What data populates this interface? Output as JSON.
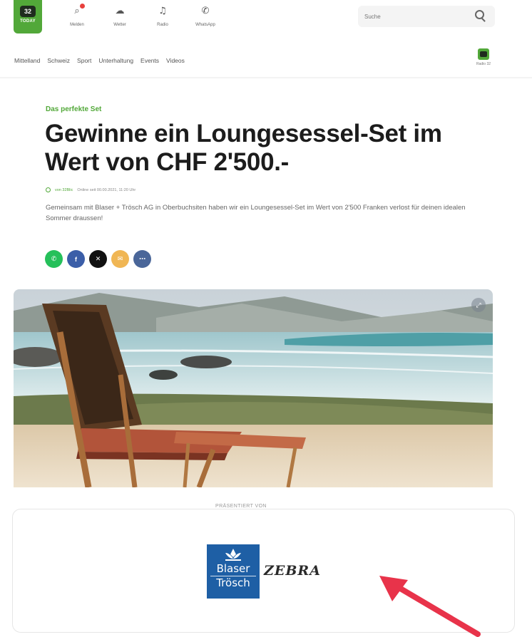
{
  "header": {
    "logo": {
      "badge": "32",
      "word": "TODAY"
    },
    "nav_icons": [
      {
        "name": "news",
        "label": "Melden",
        "icon": "notification-icon",
        "glyph": "⌕"
      },
      {
        "name": "weather",
        "label": "Wetter",
        "icon": "cloud-icon",
        "glyph": "☁"
      },
      {
        "name": "radio",
        "label": "Radio",
        "icon": "music-note-icon",
        "glyph": "♫"
      },
      {
        "name": "whatsapp",
        "label": "WhatsApp",
        "icon": "whatsapp-icon",
        "glyph": "✆"
      }
    ],
    "search": {
      "placeholder": "Suche"
    }
  },
  "subnav": {
    "items": [
      "Mittelland",
      "Schweiz",
      "Sport",
      "Unterhaltung",
      "Events",
      "Videos"
    ],
    "radio_caption": "Radio 32"
  },
  "article": {
    "kicker": "Das perfekte Set",
    "title": "Gewinne ein Loungesessel-Set im Wert von CHF 2'500.-",
    "author": "von 32Blic",
    "date": "Online seit 00.00.2021, 11:20 Uhr",
    "lead": "Gemeinsam mit Blaser + Trösch AG in Oberbuchsiten haben wir ein Loungesessel-Set im Wert von 2'500 Franken verlost für deinen idealen Sommer draussen!"
  },
  "share": [
    {
      "name": "whatsapp",
      "color": "#25c05a",
      "glyph": "✆"
    },
    {
      "name": "facebook",
      "color": "#3b5ea8",
      "glyph": "f"
    },
    {
      "name": "x",
      "color": "#111111",
      "glyph": "✕"
    },
    {
      "name": "email",
      "color": "#f0b654",
      "glyph": "✉"
    },
    {
      "name": "more",
      "color": "#4a6699",
      "glyph": "⋯"
    }
  ],
  "sponsor": {
    "label": "PRÄSENTIERT VON",
    "logo_top": "Blaser",
    "logo_bottom": "Trösch",
    "partner": "ZEBRA"
  },
  "colors": {
    "brand": "#52a839",
    "annotation_arrow": "#e8334a"
  }
}
